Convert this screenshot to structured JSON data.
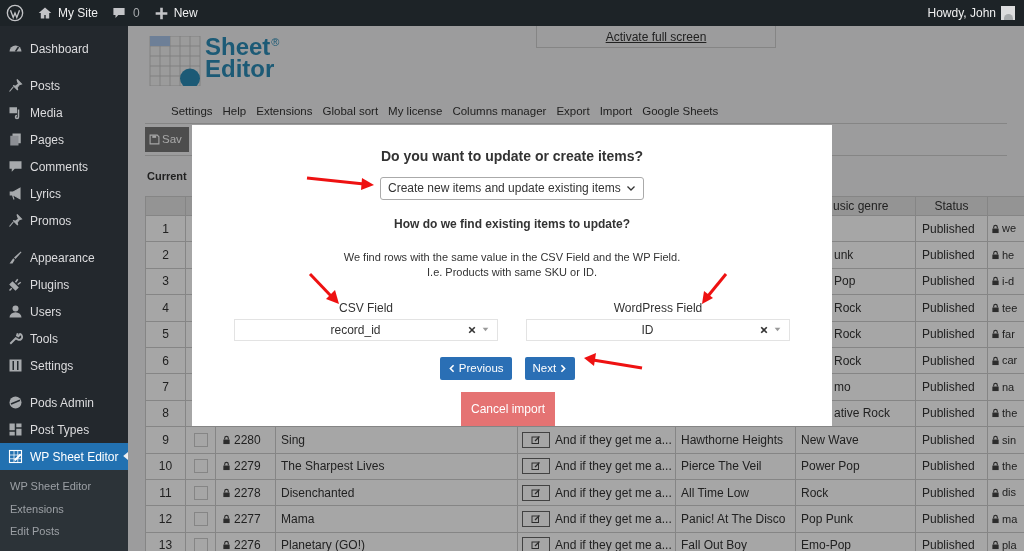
{
  "admin_bar": {
    "site": "My Site",
    "comments": "0",
    "new": "New",
    "greeting": "Howdy, John"
  },
  "sidebar": {
    "groups": [
      [
        {
          "label": "Dashboard",
          "selected": false
        }
      ],
      [
        {
          "label": "Posts",
          "selected": false
        },
        {
          "label": "Media",
          "selected": false
        },
        {
          "label": "Pages",
          "selected": false
        },
        {
          "label": "Comments",
          "selected": false
        },
        {
          "label": "Lyrics",
          "selected": false
        },
        {
          "label": "Promos",
          "selected": false
        }
      ],
      [
        {
          "label": "Appearance",
          "selected": false
        },
        {
          "label": "Plugins",
          "selected": false
        },
        {
          "label": "Users",
          "selected": false
        },
        {
          "label": "Tools",
          "selected": false
        },
        {
          "label": "Settings",
          "selected": false
        }
      ],
      [
        {
          "label": "Pods Admin",
          "selected": false
        },
        {
          "label": "Post Types",
          "selected": false
        },
        {
          "label": "WP Sheet Editor",
          "selected": true
        }
      ]
    ],
    "submenu": [
      {
        "label": "WP Sheet Editor",
        "selected": false
      },
      {
        "label": "Extensions",
        "selected": false
      },
      {
        "label": "Edit Posts",
        "selected": false
      }
    ]
  },
  "logo": {
    "line1": "Sheet",
    "line2": "Editor",
    "mark": "®"
  },
  "fullscreen_link": "Activate full screen",
  "menu": [
    "Settings",
    "Help",
    "Extensions",
    "Global sort",
    "My license",
    "Columns manager",
    "Export",
    "Import",
    "Google Sheets"
  ],
  "save_button": "Sav",
  "current_label": "Current",
  "table": {
    "columns": {
      "genre": "usic genre",
      "status": "Status"
    },
    "rows": [
      {
        "number": "1",
        "status": "Published",
        "slug": "we"
      },
      {
        "number": "2",
        "genre": "unk",
        "status": "Published",
        "slug": "he"
      },
      {
        "number": "3",
        "genre": "Pop",
        "status": "Published",
        "slug": "i-d"
      },
      {
        "number": "4",
        "genre": "Rock",
        "status": "Published",
        "slug": "tee"
      },
      {
        "number": "5",
        "genre": "Rock",
        "status": "Published",
        "slug": "far"
      },
      {
        "number": "6",
        "genre": "Rock",
        "status": "Published",
        "slug": "car"
      },
      {
        "number": "7",
        "genre": "mo",
        "status": "Published",
        "slug": "na"
      },
      {
        "number": "8",
        "genre": "ative Rock",
        "status": "Published",
        "slug": "the"
      },
      {
        "number": "9",
        "checked": false,
        "id": "2280",
        "title": "Sing",
        "excerpt": "And if they get me a...",
        "artist": "Hawthorne Heights",
        "genre": "New Wave",
        "status": "Published",
        "slug": "sin"
      },
      {
        "number": "10",
        "checked": false,
        "id": "2279",
        "title": "The Sharpest Lives",
        "excerpt": "And if they get me a...",
        "artist": "Pierce The Veil",
        "genre": "Power Pop",
        "status": "Published",
        "slug": "the"
      },
      {
        "number": "11",
        "checked": false,
        "id": "2278",
        "title": "Disenchanted",
        "excerpt": "And if they get me a...",
        "artist": "All Time Low",
        "genre": "Rock",
        "status": "Published",
        "slug": "dis"
      },
      {
        "number": "12",
        "checked": false,
        "id": "2277",
        "title": "Mama",
        "excerpt": "And if they get me a...",
        "artist": "Panic! At The Disco",
        "genre": "Pop Punk",
        "status": "Published",
        "slug": "ma"
      },
      {
        "number": "13",
        "checked": false,
        "id": "2276",
        "title": "Planetary (GO!)",
        "excerpt": "And if they get me a...",
        "artist": "Fall Out Boy",
        "genre": "Emo-Pop",
        "status": "Published",
        "slug": "pla"
      }
    ]
  },
  "modal": {
    "title": "Do you want to update or create items?",
    "mode_select": "Create new items and update existing items",
    "subtitle": "How do we find existing items to update?",
    "description": [
      "We find rows with the same value in the CSV Field and the WP Field.",
      "I.e. Products with same SKU or ID."
    ],
    "csv_label": "CSV Field",
    "csv_value": "record_id",
    "wp_label": "WordPress Field",
    "wp_value": "ID",
    "previous": "Previous",
    "next": "Next",
    "cancel": "Cancel import"
  }
}
